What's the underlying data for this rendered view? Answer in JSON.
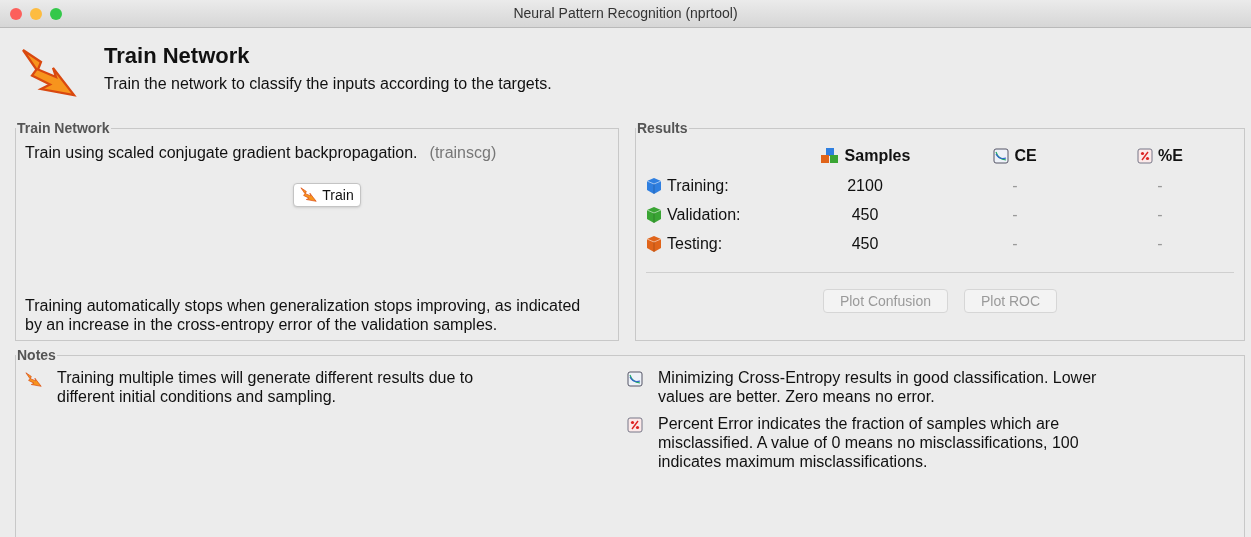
{
  "window": {
    "title": "Neural Pattern Recognition (nprtool)"
  },
  "header": {
    "title": "Train Network",
    "subtitle": "Train the network to classify the inputs according to the targets."
  },
  "train_panel": {
    "legend": "Train Network",
    "method": "Train using scaled conjugate gradient backpropagation.",
    "method_code": "(trainscg)",
    "button": {
      "label": "Train",
      "disabled": false
    },
    "note": "Training automatically stops when generalization stops improving, as indicated by an increase in the cross-entropy error of the validation samples."
  },
  "results": {
    "legend": "Results",
    "columns": [
      {
        "label": "Samples",
        "kind": "samples"
      },
      {
        "label": "CE",
        "kind": "ce"
      },
      {
        "label": "%E",
        "kind": "percent"
      }
    ],
    "rows": [
      {
        "label": "Training:",
        "kind": "training",
        "samples": "2100",
        "ce": "-",
        "percent_error": "-"
      },
      {
        "label": "Validation:",
        "kind": "validation",
        "samples": "450",
        "ce": "-",
        "percent_error": "-"
      },
      {
        "label": "Testing:",
        "kind": "testing",
        "samples": "450",
        "ce": "-",
        "percent_error": "-"
      }
    ],
    "buttons": [
      {
        "label": "Plot Confusion",
        "disabled": true
      },
      {
        "label": "Plot ROC",
        "disabled": true
      }
    ]
  },
  "notes": {
    "legend": "Notes",
    "items": [
      {
        "kind": "train",
        "text": "Training multiple times will generate different results due to different initial conditions and sampling."
      },
      {
        "kind": "ce",
        "text": "Minimizing Cross-Entropy results in good classification. Lower values are better. Zero means no error."
      },
      {
        "kind": "percent",
        "text": "Percent Error  indicates the fraction of samples which are misclassified. A value of 0 means no misclassifications, 100 indicates maximum misclassifications."
      }
    ]
  }
}
